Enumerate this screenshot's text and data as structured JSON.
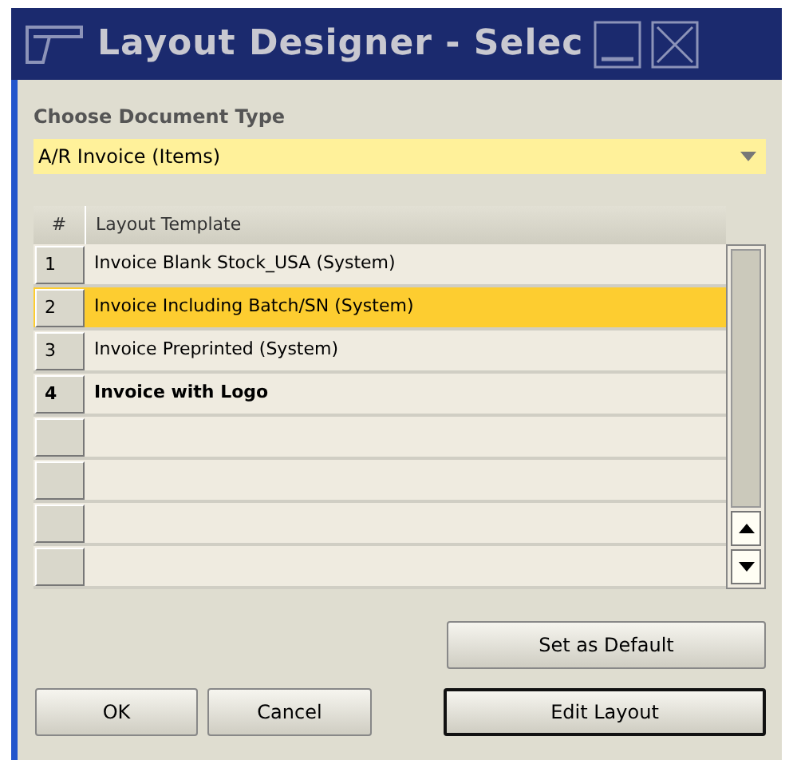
{
  "window": {
    "title": "Layout Designer - Selec"
  },
  "document_type": {
    "label": "Choose Document Type",
    "value": "A/R Invoice (Items)"
  },
  "table": {
    "columns": [
      "#",
      "Layout Template"
    ],
    "rows": [
      {
        "kind": "template",
        "number": "1",
        "template": "Invoice Blank Stock_USA (System)",
        "selected": false,
        "default": false
      },
      {
        "kind": "template",
        "number": "2",
        "template": "Invoice Including Batch/SN (System)",
        "selected": true,
        "default": false
      },
      {
        "kind": "template",
        "number": "3",
        "template": "Invoice Preprinted (System)",
        "selected": false,
        "default": false
      },
      {
        "kind": "template",
        "number": "4",
        "template": "Invoice with Logo",
        "selected": false,
        "default": true
      },
      {
        "kind": "empty",
        "selected": false
      },
      {
        "kind": "empty",
        "selected": false
      },
      {
        "kind": "empty",
        "selected": false
      },
      {
        "kind": "empty",
        "selected": false
      }
    ]
  },
  "buttons": {
    "set_default": "Set as Default",
    "ok": "OK",
    "cancel": "Cancel",
    "edit_layout": "Edit Layout"
  }
}
